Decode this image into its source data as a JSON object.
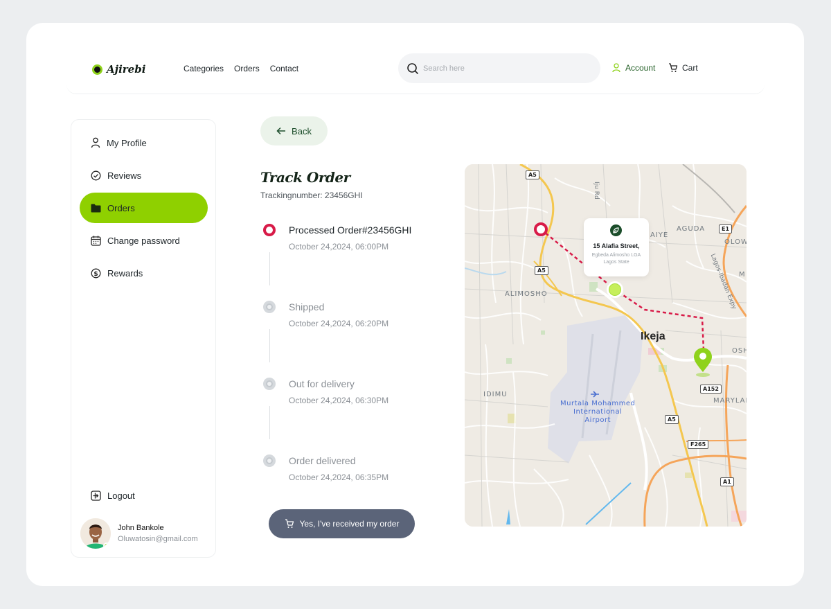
{
  "brand": {
    "name": "Ajirebi"
  },
  "nav": {
    "items": [
      "Categories",
      "Orders",
      "Contact"
    ]
  },
  "search": {
    "placeholder": "Search here"
  },
  "header": {
    "account_label": "Account",
    "cart_label": "Cart"
  },
  "sidebar": {
    "items": [
      {
        "label": "My Profile",
        "icon": "user-icon",
        "active": false
      },
      {
        "label": "Reviews",
        "icon": "badge-check-icon",
        "active": false
      },
      {
        "label": "Orders",
        "icon": "folder-icon",
        "active": true
      },
      {
        "label": "Change password",
        "icon": "calendar-icon",
        "active": false
      },
      {
        "label": "Rewards",
        "icon": "dollar-coin-icon",
        "active": false
      }
    ],
    "logout_label": "Logout"
  },
  "user": {
    "name": "John Bankole",
    "email": "Oluwatosin@gmail.com"
  },
  "back_label": "Back",
  "order": {
    "title": "Track Order",
    "tracking": "Trackingnumber: 23456GHI",
    "steps": [
      {
        "title": "Processed Order#23456GHI",
        "date": "October 24,2024, 06:00PM",
        "status": "done"
      },
      {
        "title": "Shipped",
        "date": "October 24,2024, 06:20PM",
        "status": "pending"
      },
      {
        "title": "Out for delivery",
        "date": "October 24,2024, 06:30PM",
        "status": "pending"
      },
      {
        "title": "Order delivered",
        "date": "October 24,2024, 06:35PM",
        "status": "pending"
      }
    ],
    "confirm_label": "Yes, I've received my order"
  },
  "map": {
    "labels": {
      "alimosho": "ALIMOSHO",
      "ikeja": "Ikeja",
      "idimu": "IDIMU",
      "aguda": "AGUDA",
      "olowo": "OLOWO",
      "aiye": "AIYE",
      "osh": "OSH",
      "maryland": "MARYLAI",
      "iju": "Iju Rd",
      "expy": "Lagos-Ibadan Expy",
      "m": "M"
    },
    "airport": {
      "line1": "Murtala Mohammed",
      "line2": "International",
      "line3": "Airport"
    },
    "roads": [
      "A5",
      "A5",
      "A5",
      "E1",
      "A152",
      "F265",
      "A1"
    ],
    "address": {
      "line1": "15 Alafia Street,",
      "line2": "Egbeda Alimosho LGA",
      "line3": "Lagos State"
    }
  },
  "colors": {
    "accent": "#8fd000",
    "origin_marker": "#d81b48",
    "destination_marker": "#8fd21c",
    "button_dark": "#5b6479"
  }
}
